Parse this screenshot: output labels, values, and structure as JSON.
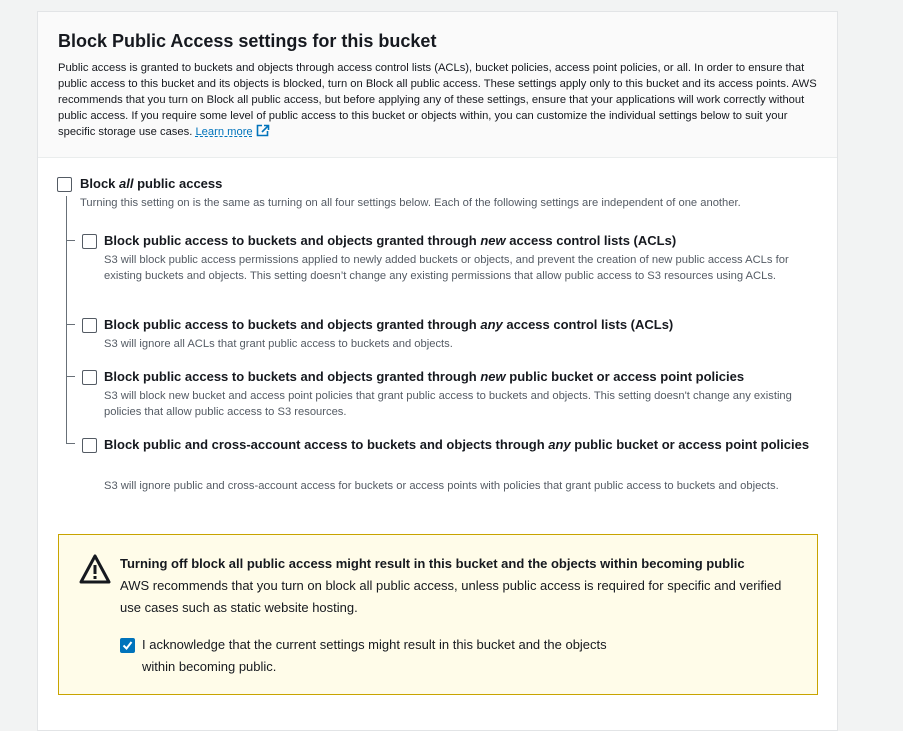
{
  "section": {
    "title": "Block Public Access settings for this bucket",
    "description": "Public access is granted to buckets and objects through access control lists (ACLs), bucket policies, access point policies, or all. In order to ensure that public access to this bucket and its objects is blocked, turn on Block all public access. These settings apply only to this bucket and its access points. AWS recommends that you turn on Block all public access, but before applying any of these settings, ensure that your applications will work correctly without public access. If you require some level of public access to this bucket or objects within, you can customize the individual settings below to suit your specific storage use cases.",
    "learn_more": "Learn more"
  },
  "block_all": {
    "label_pre": "Block ",
    "label_em": "all",
    "label_post": " public access",
    "checked": false,
    "description": "Turning this setting on is the same as turning on all four settings below. Each of the following settings are independent of one another."
  },
  "options": [
    {
      "label_pre": "Block public access to buckets and objects granted through ",
      "label_em": "new",
      "label_post": " access control lists (ACLs)",
      "checked": false,
      "description": "S3 will block public access permissions applied to newly added buckets or objects, and prevent the creation of new public access ACLs for existing buckets and objects. This setting doesn’t change any existing permissions that allow public access to S3 resources using ACLs."
    },
    {
      "label_pre": "Block public access to buckets and objects granted through ",
      "label_em": "any",
      "label_post": " access control lists (ACLs)",
      "checked": false,
      "description": "S3 will ignore all ACLs that grant public access to buckets and objects."
    },
    {
      "label_pre": "Block public access to buckets and objects granted through ",
      "label_em": "new",
      "label_post": " public bucket or access point policies",
      "checked": false,
      "description": "S3 will block new bucket and access point policies that grant public access to buckets and objects. This setting doesn't change any existing policies that allow public access to S3 resources."
    },
    {
      "label_pre": "Block public and cross-account access to buckets and objects through ",
      "label_em": "any",
      "label_post": " public bucket or access point policies",
      "checked": false,
      "description": "S3 will ignore public and cross-account access for buckets or access points with policies that grant public access to buckets and objects."
    }
  ],
  "warning": {
    "title": "Turning off block all public access might result in this bucket and the objects within becoming public",
    "body": "AWS recommends that you turn on block all public access, unless public access is required for specific and verified use cases such as static website hosting.",
    "acknowledge_label": "I acknowledge that the current settings might result in this bucket and the objects within becoming public.",
    "acknowledge_checked": true
  },
  "colors": {
    "link": "#0073bb",
    "checkbox_checked": "#0073bb",
    "warning_bg": "#fffce9",
    "warning_border": "#c8a400"
  },
  "icons": [
    "external-link-icon",
    "warning-icon",
    "checkmark-icon"
  ]
}
